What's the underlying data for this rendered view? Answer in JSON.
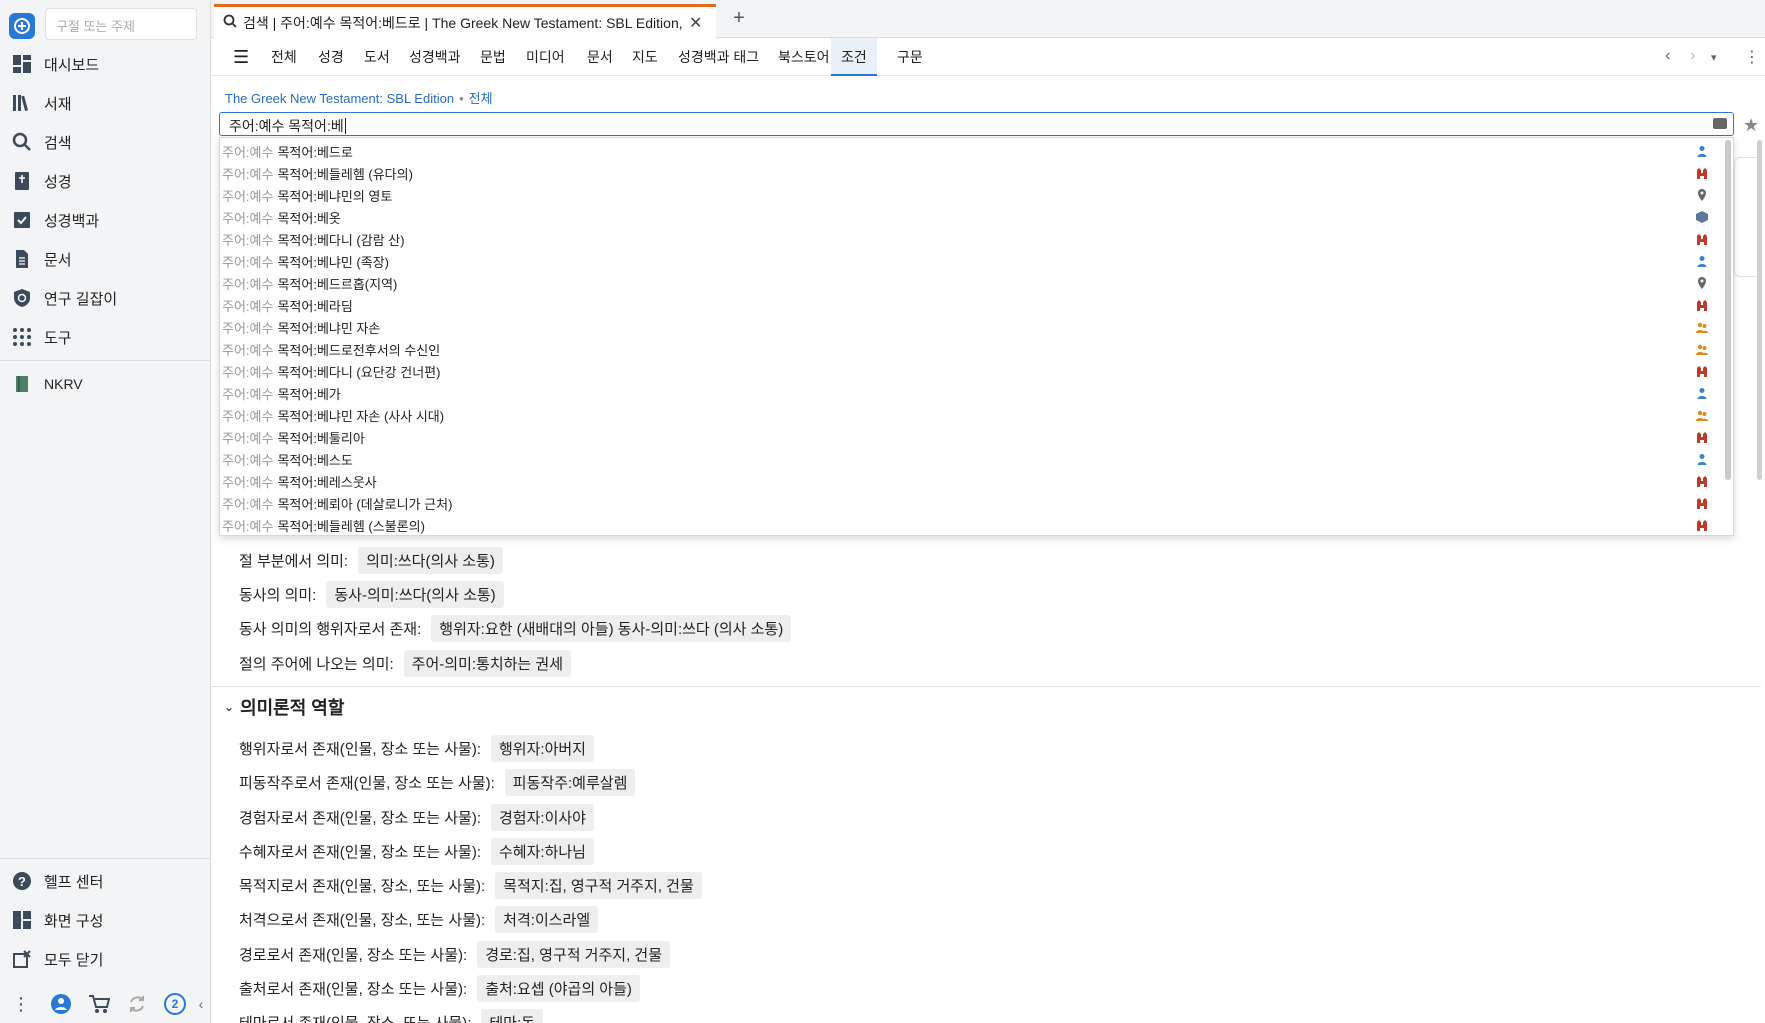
{
  "sidebar": {
    "search_placeholder": "구절 또는 주제",
    "items": [
      {
        "label": "대시보드"
      },
      {
        "label": "서재"
      },
      {
        "label": "검색"
      },
      {
        "label": "성경"
      },
      {
        "label": "성경백과"
      },
      {
        "label": "문서"
      },
      {
        "label": "연구 길잡이"
      },
      {
        "label": "도구"
      }
    ],
    "resource": "NKRV",
    "bottom_items": [
      {
        "label": "헬프 센터"
      },
      {
        "label": "화면 구성"
      },
      {
        "label": "모두 닫기"
      }
    ],
    "badge_count": "2"
  },
  "tab": {
    "title": "검색 | 주어:예수 목적어:베드로 | The Greek New Testament: SBL Edition, 전체"
  },
  "nav": {
    "items": [
      "전체",
      "성경",
      "도서",
      "성경백과",
      "문법",
      "미디어",
      "문서",
      "지도",
      "성경백과 태그",
      "북스토어",
      "조건",
      "구문"
    ],
    "active": "조건"
  },
  "breadcrumb": {
    "resource": "The Greek New Testament: SBL Edition",
    "scope": "전체"
  },
  "query": {
    "value": "주어:예수 목적어:베"
  },
  "suggestions": {
    "prefix": "주어:예수",
    "items": [
      {
        "text": "목적어:베드로",
        "icon": "person-icon",
        "color": "#3b7fd6"
      },
      {
        "text": "목적어:베들레헴 (유다의)",
        "icon": "place-icon",
        "color": "#c0392b"
      },
      {
        "text": "목적어:베냐민의 영토",
        "icon": "location-pin-icon",
        "color": "#666666"
      },
      {
        "text": "목적어:베옷",
        "icon": "object-icon",
        "color": "#5b7a99"
      },
      {
        "text": "목적어:베다니 (감람 산)",
        "icon": "place-icon",
        "color": "#c0392b"
      },
      {
        "text": "목적어:베냐민 (족장)",
        "icon": "person-icon",
        "color": "#3b7fd6"
      },
      {
        "text": "목적어:베드르홉(지역)",
        "icon": "location-pin-icon",
        "color": "#666666"
      },
      {
        "text": "목적어:베라딤",
        "icon": "place-icon",
        "color": "#c0392b"
      },
      {
        "text": "목적어:베냐민 자손",
        "icon": "group-icon",
        "color": "#e08a1e"
      },
      {
        "text": "목적어:베드로전후서의 수신인",
        "icon": "group-icon",
        "color": "#e08a1e"
      },
      {
        "text": "목적어:베다니 (요단강 건너편)",
        "icon": "place-icon",
        "color": "#c0392b"
      },
      {
        "text": "목적어:베가",
        "icon": "person-icon",
        "color": "#3b7fd6"
      },
      {
        "text": "목적어:베냐민 자손 (사사 시대)",
        "icon": "group-icon",
        "color": "#e08a1e"
      },
      {
        "text": "목적어:베툴리아",
        "icon": "place-icon",
        "color": "#c0392b"
      },
      {
        "text": "목적어:베스도",
        "icon": "person-icon",
        "color": "#3b7fd6"
      },
      {
        "text": "목적어:베레스웃사",
        "icon": "place-icon",
        "color": "#c0392b"
      },
      {
        "text": "목적어:베뢰아 (데살로니가 근처)",
        "icon": "place-icon",
        "color": "#c0392b"
      },
      {
        "text": "목적어:베들레헴 (스불론의)",
        "icon": "place-icon",
        "color": "#c0392b"
      }
    ]
  },
  "meaning_rows": [
    {
      "label": "절 부분에서 의미:",
      "chip": "의미:쓰다(의사 소통)"
    },
    {
      "label": "동사의 의미:",
      "chip": "동사-의미:쓰다(의사 소통)"
    },
    {
      "label": "동사 의미의 행위자로서 존재:",
      "chip": "행위자:요한 (새배대의 아들) 동사-의미:쓰다 (의사 소통)"
    },
    {
      "label": "절의 주어에 나오는 의미:",
      "chip": "주어-의미:통치하는 권세"
    }
  ],
  "semantic_section": {
    "title": "의미론적 역할",
    "rows": [
      {
        "label": "행위자로서 존재(인물, 장소 또는 사물):",
        "chip": "행위자:아버지"
      },
      {
        "label": "피동작주로서 존재(인물, 장소 또는 사물):",
        "chip": "피동작주:예루살렘"
      },
      {
        "label": "경험자로서 존재(인물, 장소 또는 사물):",
        "chip": "경험자:이사야"
      },
      {
        "label": "수혜자로서 존재(인물, 장소 또는 사물):",
        "chip": "수혜자:하나님"
      },
      {
        "label": "목적지로서 존재(인물, 장소, 또는 사물):",
        "chip": "목적지:집, 영구적 거주지, 건물"
      },
      {
        "label": "처격으로서 존재(인물, 장소, 또는 사물):",
        "chip": "처격:이스라엘"
      },
      {
        "label": "경로로서 존재(인물, 장소 또는 사물):",
        "chip": "경로:집, 영구적 거주지, 건물"
      },
      {
        "label": "출처로서 존재(인물, 장소 또는 사물):",
        "chip": "출처:요셉 (야곱의 아들)"
      },
      {
        "label": "테마로서 존재(인물, 장소, 또는 사물):",
        "chip": "테마:돈"
      }
    ]
  }
}
